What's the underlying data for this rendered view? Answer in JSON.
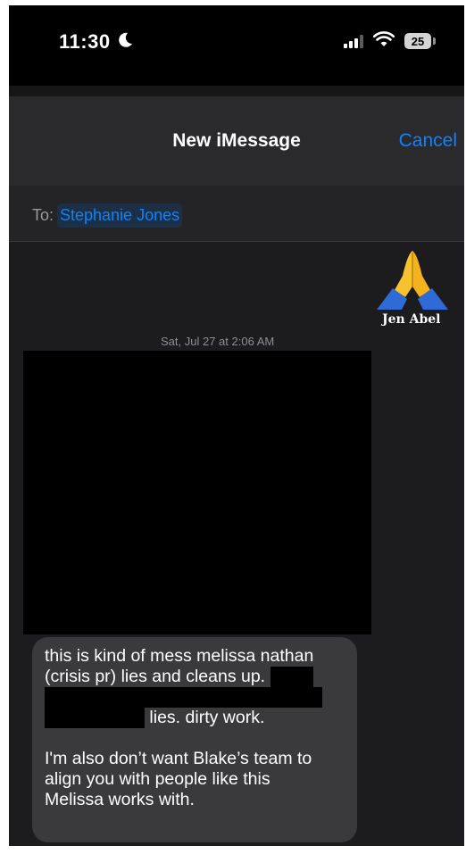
{
  "status_bar": {
    "time": "11:30",
    "battery_level": "25",
    "icons": [
      "moon-icon",
      "cellular-signal-icon",
      "wifi-icon",
      "battery-icon"
    ]
  },
  "compose": {
    "title": "New iMessage",
    "cancel_label": "Cancel"
  },
  "to_field": {
    "label": "To:",
    "recipient": "Stephanie Jones"
  },
  "conversation": {
    "sender_avatar_icon": "folded-hands-emoji-icon",
    "sender_name": "Jen Abel",
    "timestamp": "Sat, Jul 27 at 2:06 AM",
    "message": {
      "line1": "this is kind of mess melissa nathan",
      "line2": "(crisis pr) lies and cleans up.",
      "line3_tail": "lies. dirty work.",
      "line4": "I'm also don’t want Blake’s team to",
      "line5": "align you with people like this",
      "line6": "Melissa works with."
    }
  },
  "colors": {
    "accent": "#0a84ff",
    "background": "#1c1c1e",
    "bubble": "#3a3a3c",
    "redaction": "#000000"
  }
}
